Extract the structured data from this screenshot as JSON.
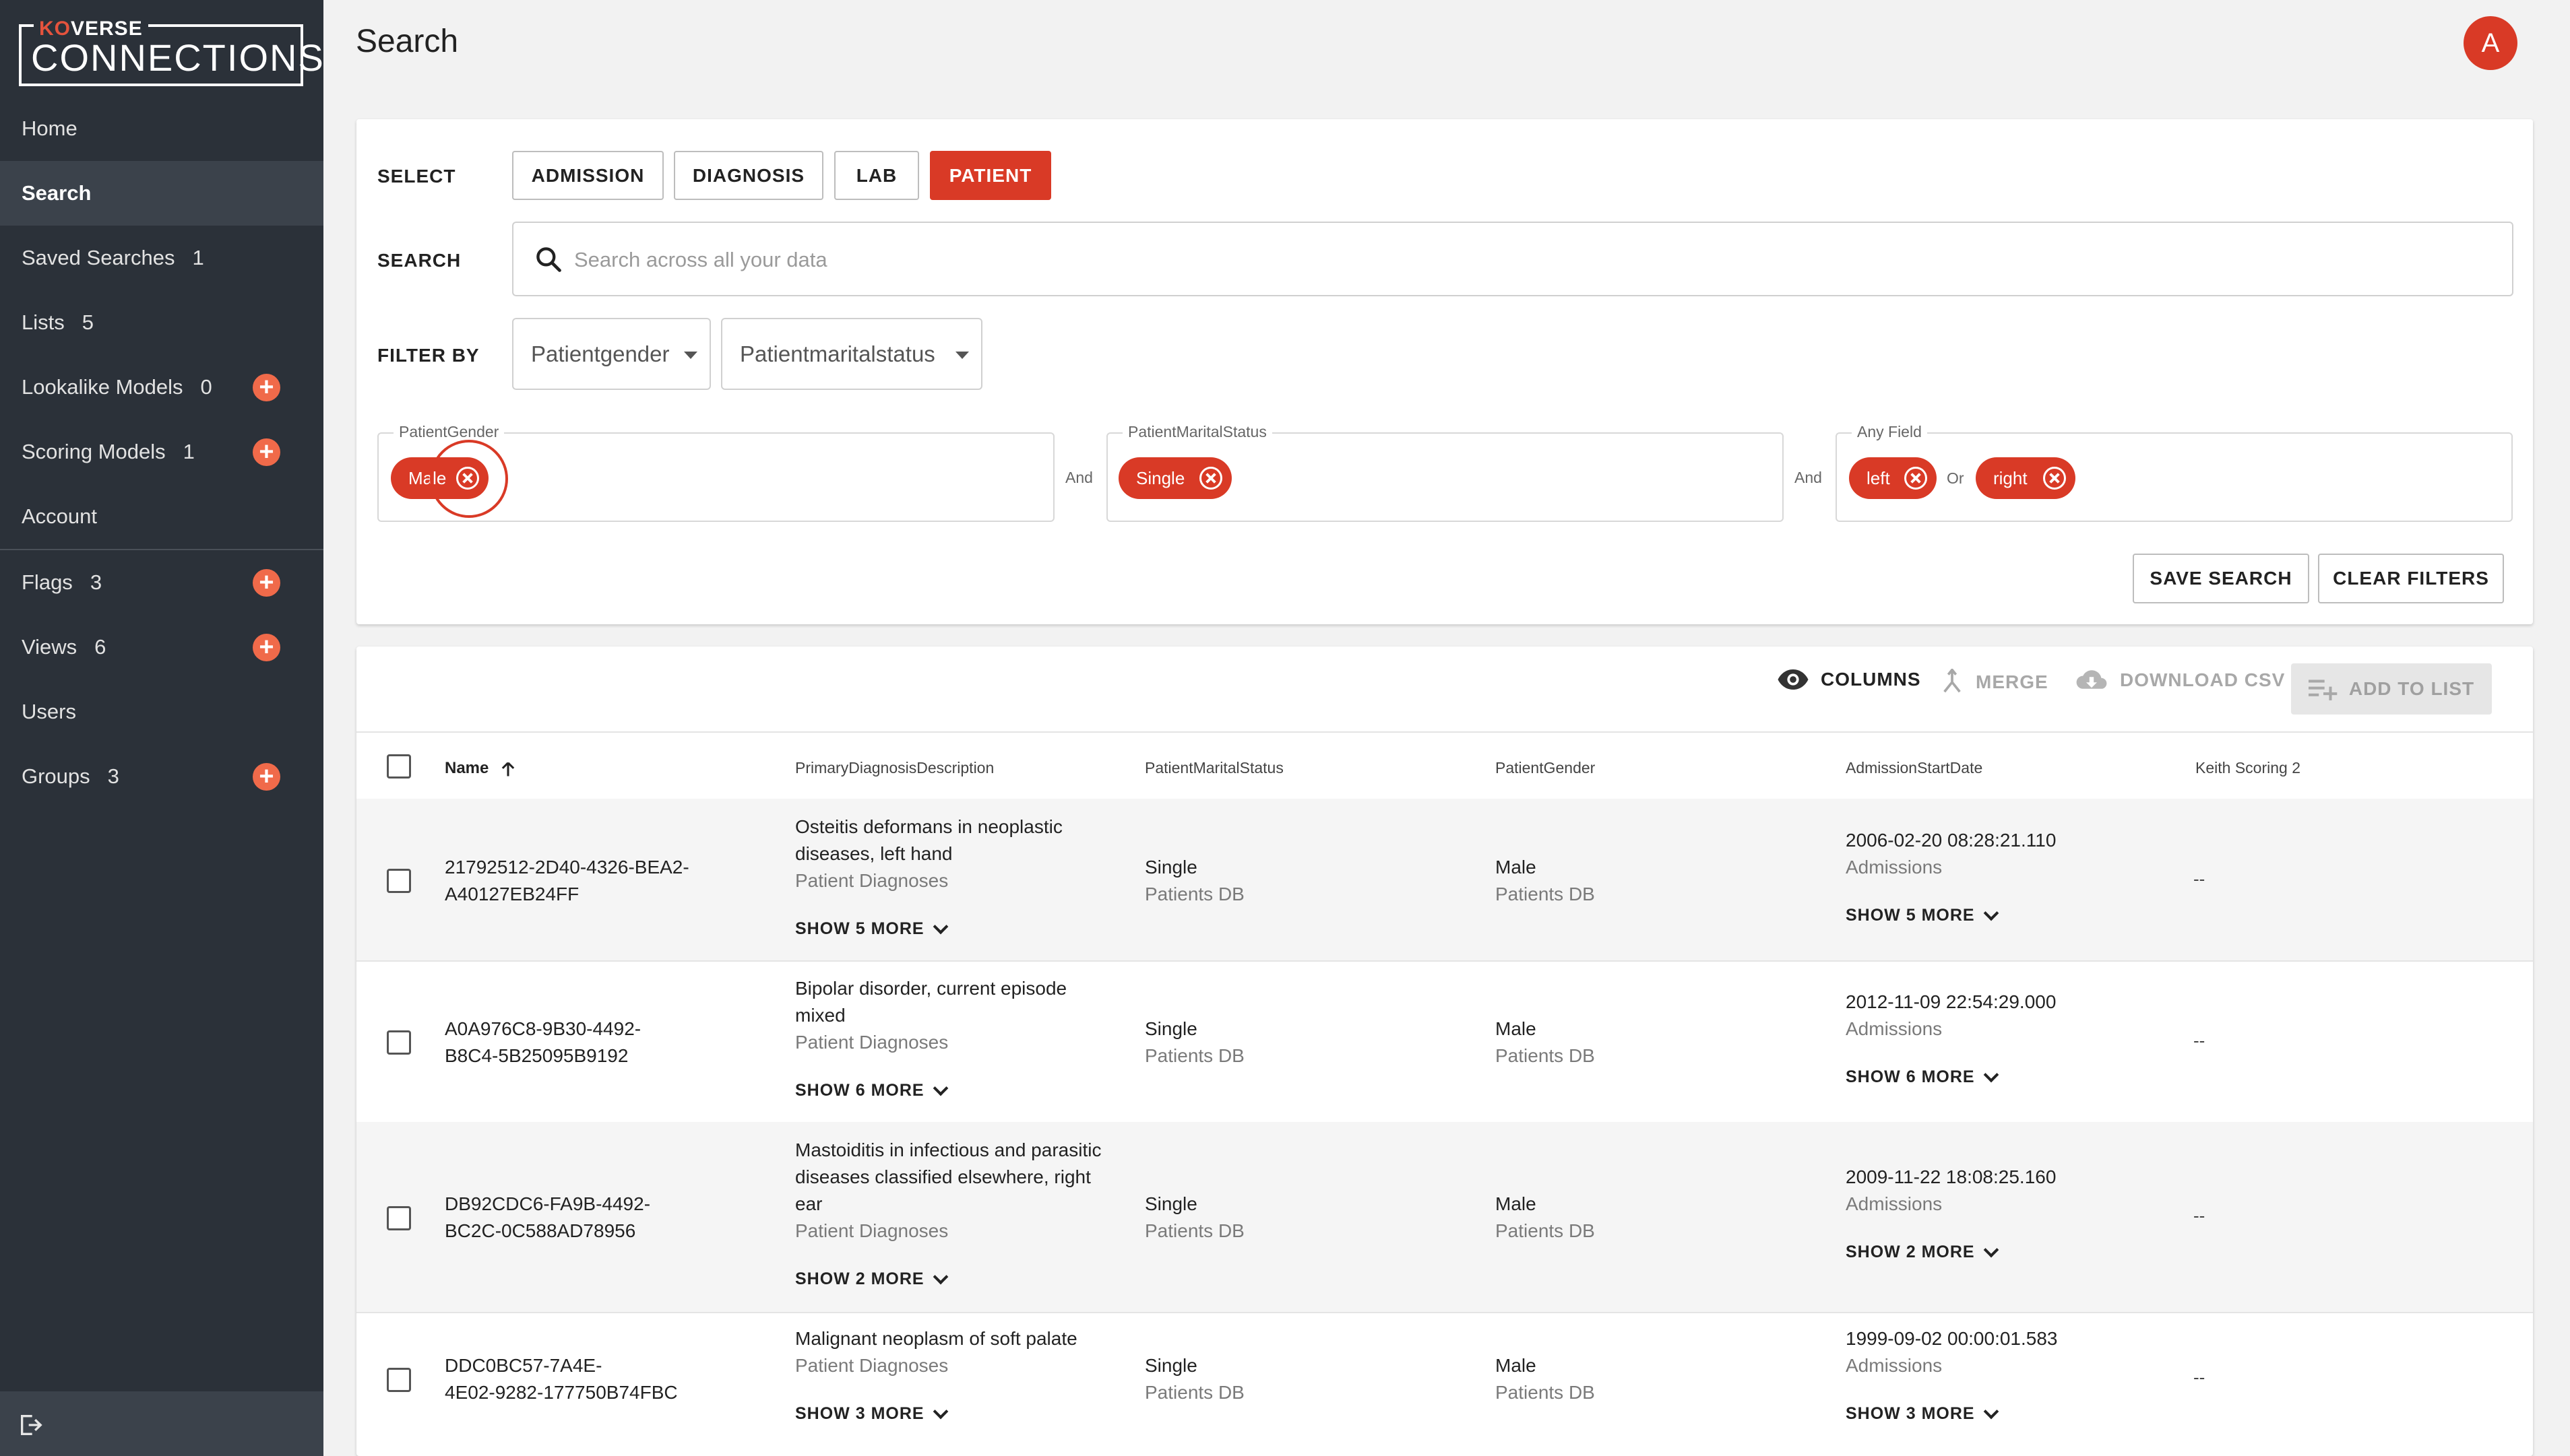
{
  "app": {
    "logo_top_ko": "KO",
    "logo_top_rest": "VERSE",
    "logo_main": "CONNECTIONS"
  },
  "sidebar": {
    "items": [
      {
        "label": "Home",
        "count": ""
      },
      {
        "label": "Search",
        "count": ""
      },
      {
        "label": "Saved Searches",
        "count": "1"
      },
      {
        "label": "Lists",
        "count": "5"
      },
      {
        "label": "Lookalike Models",
        "count": "0"
      },
      {
        "label": "Scoring Models",
        "count": "1"
      },
      {
        "label": "Account",
        "count": ""
      },
      {
        "label": "Flags",
        "count": "3"
      },
      {
        "label": "Views",
        "count": "6"
      },
      {
        "label": "Users",
        "count": ""
      },
      {
        "label": "Groups",
        "count": "3"
      }
    ]
  },
  "header": {
    "title": "Search",
    "avatar_initial": "A"
  },
  "search_panel": {
    "select_label": "SELECT",
    "types": [
      "ADMISSION",
      "DIAGNOSIS",
      "LAB",
      "PATIENT"
    ],
    "active_type": "PATIENT",
    "search_label": "SEARCH",
    "search_placeholder": "Search across all your data",
    "search_value": "",
    "filter_label": "FILTER BY",
    "filter_selects": [
      "Patientgender",
      "Patientmaritalstatus"
    ],
    "filters": [
      {
        "legend": "PatientGender",
        "chips": [
          "Male"
        ]
      },
      {
        "legend": "PatientMaritalStatus",
        "chips": [
          "Single"
        ]
      },
      {
        "legend": "Any Field",
        "chips": [
          "left",
          "right"
        ]
      }
    ],
    "conj_and": "And",
    "conj_or": "Or",
    "save_search": "SAVE SEARCH",
    "clear_filters": "CLEAR FILTERS"
  },
  "toolbar": {
    "columns": "COLUMNS",
    "merge": "MERGE",
    "download_csv": "DOWNLOAD CSV",
    "add_to_list": "ADD TO LIST"
  },
  "table": {
    "headers": [
      "Name",
      "PrimaryDiagnosisDescription",
      "PatientMaritalStatus",
      "PatientGender",
      "AdmissionStartDate",
      "Keith Scoring 2"
    ],
    "rows": [
      {
        "name_lines": [
          "21792512-2D40-4326-BEA2-",
          "A40127EB24FF"
        ],
        "diag_lines": [
          "Osteitis deformans in neoplastic",
          "diseases, left hand"
        ],
        "diag_source": "Patient Diagnoses",
        "diag_more": "SHOW 5 MORE",
        "marital": "Single",
        "marital_source": "Patients DB",
        "gender": "Male",
        "gender_source": "Patients DB",
        "admission": "2006-02-20 08:28:21.110",
        "admission_source": "Admissions",
        "admission_more": "SHOW 5 MORE",
        "score": "--"
      },
      {
        "name_lines": [
          "A0A976C8-9B30-4492-",
          "B8C4-5B25095B9192"
        ],
        "diag_lines": [
          "Bipolar disorder, current episode",
          "mixed"
        ],
        "diag_source": "Patient Diagnoses",
        "diag_more": "SHOW 6 MORE",
        "marital": "Single",
        "marital_source": "Patients DB",
        "gender": "Male",
        "gender_source": "Patients DB",
        "admission": "2012-11-09 22:54:29.000",
        "admission_source": "Admissions",
        "admission_more": "SHOW 6 MORE",
        "score": "--"
      },
      {
        "name_lines": [
          "DB92CDC6-FA9B-4492-",
          "BC2C-0C588AD78956"
        ],
        "diag_lines": [
          "Mastoiditis in infectious and parasitic",
          "diseases classified elsewhere, right",
          "ear"
        ],
        "diag_source": "Patient Diagnoses",
        "diag_more": "SHOW 2 MORE",
        "marital": "Single",
        "marital_source": "Patients DB",
        "gender": "Male",
        "gender_source": "Patients DB",
        "admission": "2009-11-22 18:08:25.160",
        "admission_source": "Admissions",
        "admission_more": "SHOW 2 MORE",
        "score": "--"
      },
      {
        "name_lines": [
          "DDC0BC57-7A4E-",
          "4E02-9282-177750B74FBC"
        ],
        "diag_lines": [
          "Malignant neoplasm of soft palate"
        ],
        "diag_source": "Patient Diagnoses",
        "diag_more": "SHOW 3 MORE",
        "marital": "Single",
        "marital_source": "Patients DB",
        "gender": "Male",
        "gender_source": "Patients DB",
        "admission": "1999-09-02 00:00:01.583",
        "admission_source": "Admissions",
        "admission_more": "SHOW 3 MORE",
        "score": "--"
      }
    ]
  },
  "colors": {
    "accent": "#d93a26",
    "plus": "#f06a4a",
    "sidebar": "#2b3139"
  }
}
